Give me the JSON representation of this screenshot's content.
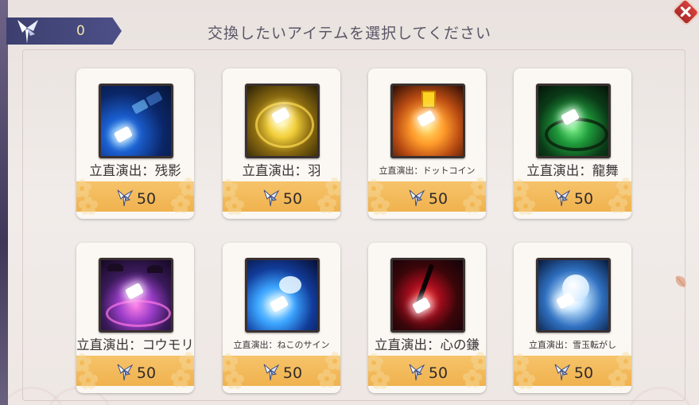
{
  "header": {
    "currency_count": "0",
    "title": "交換したいアイテムを選択してください",
    "currency_icon": "feather-key-icon",
    "close_icon": "close-x-icon"
  },
  "colors": {
    "price_bar": "#f2b652",
    "card_bg": "#fbf8f3",
    "close_button": "#c23533",
    "currency_bar": "#434679"
  },
  "items": [
    {
      "name": "立直演出：残影",
      "price": "50",
      "size": "big",
      "theme": "blue-afterimage"
    },
    {
      "name": "立直演出：羽",
      "price": "50",
      "size": "big",
      "theme": "gold-feather"
    },
    {
      "name": "立直演出：ドットコイン",
      "price": "50",
      "size": "small",
      "theme": "pixel-coin"
    },
    {
      "name": "立直演出：龍舞",
      "price": "50",
      "size": "big",
      "theme": "green-dragon"
    },
    {
      "name": "立直演出：コウモリ",
      "price": "50",
      "size": "big",
      "theme": "purple-bat"
    },
    {
      "name": "立直演出：ねこのサイン",
      "price": "50",
      "size": "small",
      "theme": "blue-paw"
    },
    {
      "name": "立直演出：心の鎌",
      "price": "50",
      "size": "big",
      "theme": "red-scythe"
    },
    {
      "name": "立直演出：雪玉転がし",
      "price": "50",
      "size": "small",
      "theme": "snowball"
    }
  ]
}
